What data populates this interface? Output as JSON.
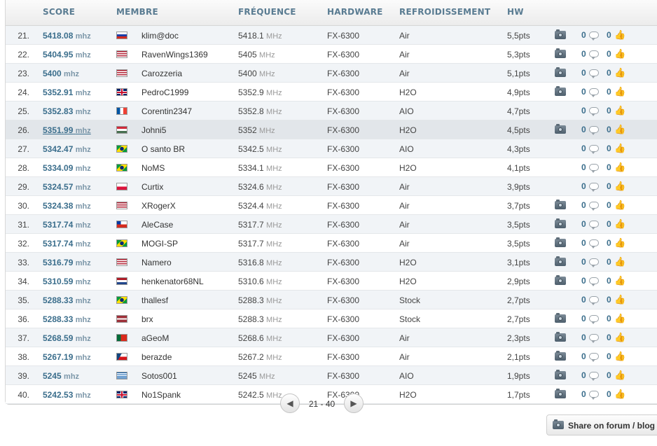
{
  "columns": {
    "score": "SCORE",
    "member": "MEMBRE",
    "frequency": "FRÉQUENCE",
    "hardware": "HARDWARE",
    "cooling": "REFROIDISSEMENT",
    "hw": "HW"
  },
  "rows": [
    {
      "rank": "21.",
      "score": "5418.08",
      "score_unit": "mhz",
      "flag": "russia",
      "member": "klim@doc",
      "freq": "5418.1",
      "freq_unit": "MHz",
      "hardware": "FX-6300",
      "cooling": "Air",
      "hw": "5,5pts",
      "camera": true,
      "comments": "0",
      "likes": "0"
    },
    {
      "rank": "22.",
      "score": "5404.95",
      "score_unit": "mhz",
      "flag": "usa",
      "member": "RavenWings1369",
      "freq": "5405",
      "freq_unit": "MHz",
      "hardware": "FX-6300",
      "cooling": "Air",
      "hw": "5,3pts",
      "camera": true,
      "comments": "0",
      "likes": "0"
    },
    {
      "rank": "23.",
      "score": "5400",
      "score_unit": "mhz",
      "flag": "usa",
      "member": "Carozzeria",
      "freq": "5400",
      "freq_unit": "MHz",
      "hardware": "FX-6300",
      "cooling": "Air",
      "hw": "5,1pts",
      "camera": true,
      "comments": "0",
      "likes": "0"
    },
    {
      "rank": "24.",
      "score": "5352.91",
      "score_unit": "mhz",
      "flag": "uk",
      "member": "PedroC1999",
      "freq": "5352.9",
      "freq_unit": "MHz",
      "hardware": "FX-6300",
      "cooling": "H2O",
      "hw": "4,9pts",
      "camera": true,
      "comments": "0",
      "likes": "0"
    },
    {
      "rank": "25.",
      "score": "5352.83",
      "score_unit": "mhz",
      "flag": "france",
      "member": "Corentin2347",
      "freq": "5352.8",
      "freq_unit": "MHz",
      "hardware": "FX-6300",
      "cooling": "AIO",
      "hw": "4,7pts",
      "camera": false,
      "comments": "0",
      "likes": "0"
    },
    {
      "rank": "26.",
      "score": "5351.99",
      "score_unit": "mhz",
      "flag": "hungary",
      "member": "Johni5",
      "freq": "5352",
      "freq_unit": "MHz",
      "hardware": "FX-6300",
      "cooling": "H2O",
      "hw": "4,5pts",
      "camera": true,
      "comments": "0",
      "likes": "0",
      "highlight": true
    },
    {
      "rank": "27.",
      "score": "5342.47",
      "score_unit": "mhz",
      "flag": "brazil",
      "member": "O santo BR",
      "freq": "5342.5",
      "freq_unit": "MHz",
      "hardware": "FX-6300",
      "cooling": "AIO",
      "hw": "4,3pts",
      "camera": false,
      "comments": "0",
      "likes": "0"
    },
    {
      "rank": "28.",
      "score": "5334.09",
      "score_unit": "mhz",
      "flag": "brazil",
      "member": "NoMS",
      "freq": "5334.1",
      "freq_unit": "MHz",
      "hardware": "FX-6300",
      "cooling": "H2O",
      "hw": "4,1pts",
      "camera": false,
      "comments": "0",
      "likes": "0"
    },
    {
      "rank": "29.",
      "score": "5324.57",
      "score_unit": "mhz",
      "flag": "poland",
      "member": "Curtix",
      "freq": "5324.6",
      "freq_unit": "MHz",
      "hardware": "FX-6300",
      "cooling": "Air",
      "hw": "3,9pts",
      "camera": false,
      "comments": "0",
      "likes": "0"
    },
    {
      "rank": "30.",
      "score": "5324.38",
      "score_unit": "mhz",
      "flag": "usa",
      "member": "XRogerX",
      "freq": "5324.4",
      "freq_unit": "MHz",
      "hardware": "FX-6300",
      "cooling": "Air",
      "hw": "3,7pts",
      "camera": true,
      "comments": "0",
      "likes": "0"
    },
    {
      "rank": "31.",
      "score": "5317.74",
      "score_unit": "mhz",
      "flag": "chile",
      "member": "AleCase",
      "freq": "5317.7",
      "freq_unit": "MHz",
      "hardware": "FX-6300",
      "cooling": "Air",
      "hw": "3,5pts",
      "camera": true,
      "comments": "0",
      "likes": "0"
    },
    {
      "rank": "32.",
      "score": "5317.74",
      "score_unit": "mhz",
      "flag": "brazil",
      "member": "MOGI-SP",
      "freq": "5317.7",
      "freq_unit": "MHz",
      "hardware": "FX-6300",
      "cooling": "Air",
      "hw": "3,5pts",
      "camera": true,
      "comments": "0",
      "likes": "0"
    },
    {
      "rank": "33.",
      "score": "5316.79",
      "score_unit": "mhz",
      "flag": "usa",
      "member": "Namero",
      "freq": "5316.8",
      "freq_unit": "MHz",
      "hardware": "FX-6300",
      "cooling": "H2O",
      "hw": "3,1pts",
      "camera": true,
      "comments": "0",
      "likes": "0"
    },
    {
      "rank": "34.",
      "score": "5310.59",
      "score_unit": "mhz",
      "flag": "netherlands",
      "member": "henkenator68NL",
      "freq": "5310.6",
      "freq_unit": "MHz",
      "hardware": "FX-6300",
      "cooling": "H2O",
      "hw": "2,9pts",
      "camera": true,
      "comments": "0",
      "likes": "0"
    },
    {
      "rank": "35.",
      "score": "5288.33",
      "score_unit": "mhz",
      "flag": "brazil",
      "member": "thallesf",
      "freq": "5288.3",
      "freq_unit": "MHz",
      "hardware": "FX-6300",
      "cooling": "Stock",
      "hw": "2,7pts",
      "camera": false,
      "comments": "0",
      "likes": "0"
    },
    {
      "rank": "36.",
      "score": "5288.33",
      "score_unit": "mhz",
      "flag": "latvia",
      "member": "brx",
      "freq": "5288.3",
      "freq_unit": "MHz",
      "hardware": "FX-6300",
      "cooling": "Stock",
      "hw": "2,7pts",
      "camera": true,
      "comments": "0",
      "likes": "0"
    },
    {
      "rank": "37.",
      "score": "5268.59",
      "score_unit": "mhz",
      "flag": "portugal",
      "member": "aGeoM",
      "freq": "5268.6",
      "freq_unit": "MHz",
      "hardware": "FX-6300",
      "cooling": "Air",
      "hw": "2,3pts",
      "camera": true,
      "comments": "0",
      "likes": "0"
    },
    {
      "rank": "38.",
      "score": "5267.19",
      "score_unit": "mhz",
      "flag": "czech",
      "member": "berazde",
      "freq": "5267.2",
      "freq_unit": "MHz",
      "hardware": "FX-6300",
      "cooling": "Air",
      "hw": "2,1pts",
      "camera": true,
      "comments": "0",
      "likes": "0"
    },
    {
      "rank": "39.",
      "score": "5245",
      "score_unit": "mhz",
      "flag": "greece",
      "member": "Sotos001",
      "freq": "5245",
      "freq_unit": "MHz",
      "hardware": "FX-6300",
      "cooling": "AIO",
      "hw": "1,9pts",
      "camera": true,
      "comments": "0",
      "likes": "0"
    },
    {
      "rank": "40.",
      "score": "5242.53",
      "score_unit": "mhz",
      "flag": "uk",
      "member": "No1Spank",
      "freq": "5242.5",
      "freq_unit": "MHz",
      "hardware": "FX-6300",
      "cooling": "H2O",
      "hw": "1,7pts",
      "camera": true,
      "comments": "0",
      "likes": "0"
    }
  ],
  "pager": {
    "label": "21 - 40",
    "prev_icon": "chevron-left-icon",
    "next_icon": "chevron-right-icon"
  },
  "share": {
    "label": "Share on forum / blog",
    "icon": "camera-icon"
  },
  "colors": {
    "accent": "#3b6e8c",
    "header_text": "#5a7c92",
    "row_alt": "#f1f4f7",
    "row_highlight": "#e2e6ea"
  }
}
